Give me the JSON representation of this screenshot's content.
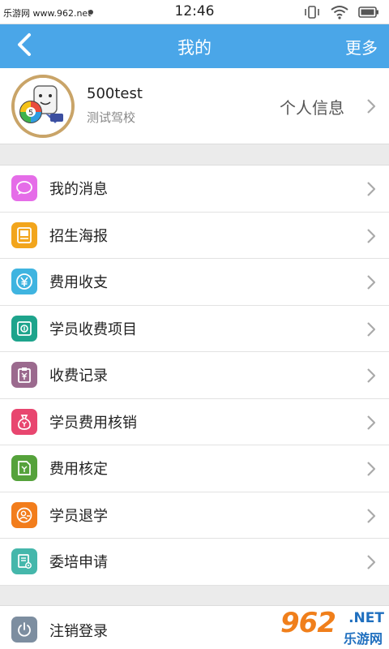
{
  "status_bar": {
    "watermark_text": "乐游网 www.962.net",
    "time": "12:46",
    "icons": [
      "vibrate-icon",
      "wifi-icon",
      "battery-icon"
    ]
  },
  "header": {
    "back_icon": "chevron-left-icon",
    "title": "我的",
    "more_label": "更多",
    "color": "#4aa6e8"
  },
  "profile": {
    "name": "500test",
    "school": "测试驾校",
    "info_link": "个人信息"
  },
  "menu": {
    "items": [
      {
        "label": "我的消息",
        "icon": "message-icon",
        "color": "#e56de8"
      },
      {
        "label": "招生海报",
        "icon": "poster-icon",
        "color": "#f2a51c"
      },
      {
        "label": "费用收支",
        "icon": "yuan-icon",
        "color": "#3fb4e0"
      },
      {
        "label": "学员收费项目",
        "icon": "fee-item-icon",
        "color": "#1ea48c"
      },
      {
        "label": "收费记录",
        "icon": "fee-record-icon",
        "color": "#9b6a8e"
      },
      {
        "label": "学员费用核销",
        "icon": "moneybag-icon",
        "color": "#e8466f"
      },
      {
        "label": "费用核定",
        "icon": "fee-approve-icon",
        "color": "#55a23b"
      },
      {
        "label": "学员退学",
        "icon": "student-quit-icon",
        "color": "#f27d1c"
      },
      {
        "label": "委培申请",
        "icon": "apply-form-icon",
        "color": "#45b7ab"
      }
    ]
  },
  "logout": {
    "label": "注销登录",
    "icon": "power-icon",
    "color": "#7d8ea0"
  },
  "watermark": {
    "number": "962",
    "net": ".NET",
    "cn": "乐游网"
  }
}
